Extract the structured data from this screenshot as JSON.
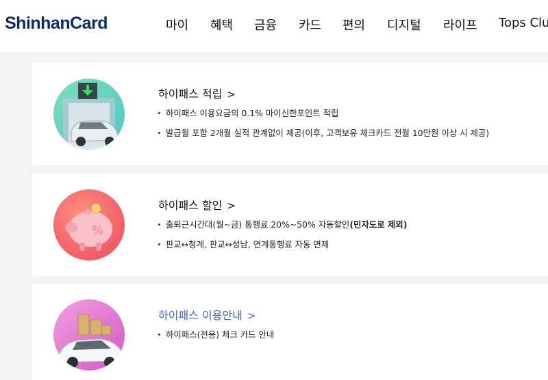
{
  "header": {
    "logo": "ShinhanCard",
    "nav": [
      "마이",
      "혜택",
      "금융",
      "카드",
      "편의",
      "디지털",
      "라이프",
      "Tops Club"
    ]
  },
  "cards": [
    {
      "title": "하이패스 적립",
      "chevron": ">",
      "bullets": [
        {
          "text": "하이패스 이용요금의 0.1% 마이신한포인트 적립"
        },
        {
          "text": "발급월 포함 2개월 실적 관계없이 제공(이후, 고객보유 체크카드 전월 10만원 이상 시 제공)"
        }
      ],
      "icon": "tollgate-car-icon",
      "accent": "#5fd3b0"
    },
    {
      "title": "하이패스 할인",
      "chevron": ">",
      "bullets": [
        {
          "text": "출퇴근시간대(월~금) 통행료 20%~50% 자동할인",
          "bold": "(민자도로 제외)"
        },
        {
          "text": "판교↔청계, 판교↔성남, 연계통행료 자동 면제"
        }
      ],
      "icon": "piggy-bank-icon",
      "accent": "#f26d6b"
    },
    {
      "title": "하이패스 이용안내",
      "chevron": ">",
      "bullets": [
        {
          "text": "하이패스(전용) 체크 카드 안내"
        }
      ],
      "icon": "car-coins-icon",
      "accent": "#e77ccf",
      "title_color": "#4a62c9"
    }
  ]
}
